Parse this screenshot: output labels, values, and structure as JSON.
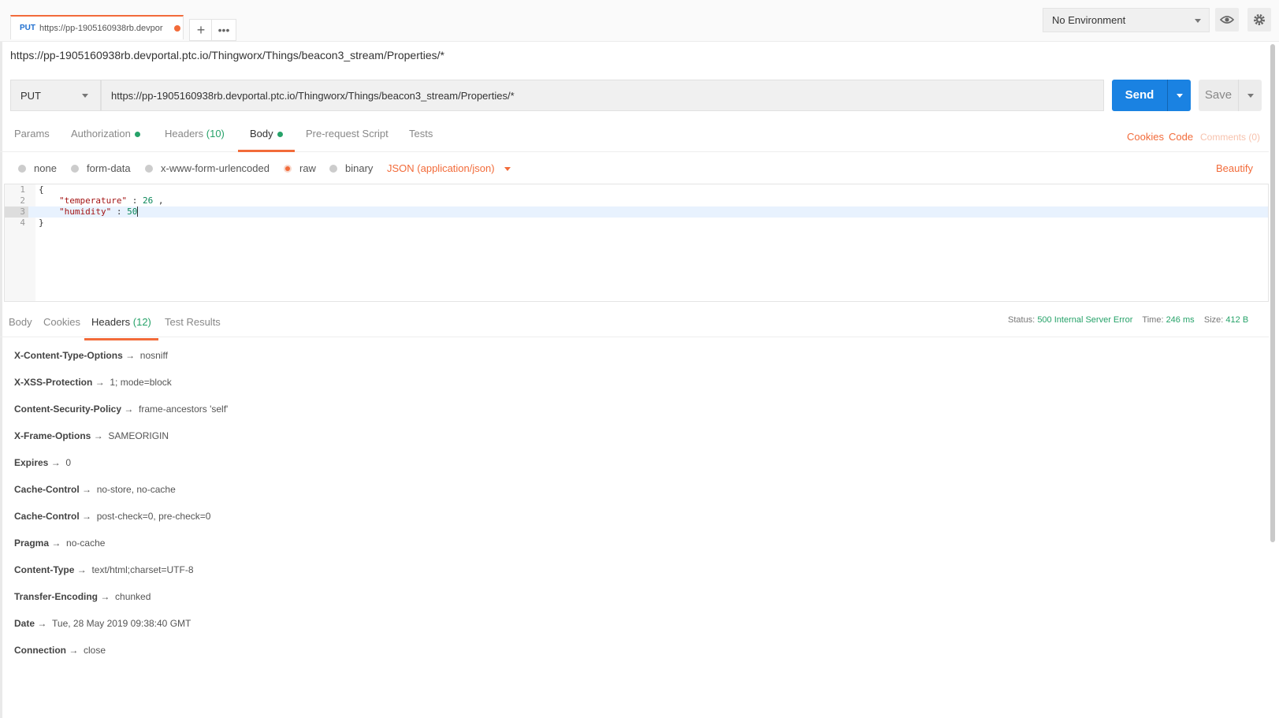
{
  "tab": {
    "method": "PUT",
    "url": "https://pp-1905160938rb.devpor"
  },
  "environment": {
    "selected": "No Environment"
  },
  "request": {
    "title": "https://pp-1905160938rb.devportal.ptc.io/Thingworx/Things/beacon3_stream/Properties/*",
    "method": "PUT",
    "url": "https://pp-1905160938rb.devportal.ptc.io/Thingworx/Things/beacon3_stream/Properties/*",
    "send_label": "Send",
    "save_label": "Save"
  },
  "request_tabs": {
    "params": "Params",
    "authorization": "Authorization",
    "headers": "Headers",
    "headers_count": "(10)",
    "body": "Body",
    "prerequest": "Pre-request Script",
    "tests": "Tests"
  },
  "right_links": {
    "cookies": "Cookies",
    "code": "Code",
    "comments": "Comments (0)"
  },
  "body_types": {
    "none": "none",
    "form_data": "form-data",
    "urlencoded": "x-www-form-urlencoded",
    "raw": "raw",
    "binary": "binary",
    "format": "JSON (application/json)",
    "beautify": "Beautify"
  },
  "editor": {
    "lines": [
      "1",
      "2",
      "3",
      "4"
    ],
    "open": "{",
    "key1": "\"temperature\"",
    "sep1": " : ",
    "val1": "26",
    "tail1": " ,",
    "key2": "\"humidity\"",
    "sep2": " : ",
    "val2": "50",
    "close": "}"
  },
  "response_tabs": {
    "body": "Body",
    "cookies": "Cookies",
    "headers": "Headers",
    "headers_count": "(12)",
    "tests": "Test Results"
  },
  "status": {
    "status_label": "Status:",
    "status_value": "500 Internal Server Error",
    "time_label": "Time:",
    "time_value": "246 ms",
    "size_label": "Size:",
    "size_value": "412 B"
  },
  "response_headers": [
    {
      "key": "X-Content-Type-Options",
      "value": "nosniff"
    },
    {
      "key": "X-XSS-Protection",
      "value": "1; mode=block"
    },
    {
      "key": "Content-Security-Policy",
      "value": "frame-ancestors 'self'"
    },
    {
      "key": "X-Frame-Options",
      "value": "SAMEORIGIN"
    },
    {
      "key": "Expires",
      "value": "0"
    },
    {
      "key": "Cache-Control",
      "value": "no-store, no-cache"
    },
    {
      "key": "Cache-Control",
      "value": "post-check=0, pre-check=0"
    },
    {
      "key": "Pragma",
      "value": "no-cache"
    },
    {
      "key": "Content-Type",
      "value": "text/html;charset=UTF-8"
    },
    {
      "key": "Transfer-Encoding",
      "value": "chunked"
    },
    {
      "key": "Date",
      "value": "Tue, 28 May 2019 09:38:40 GMT"
    },
    {
      "key": "Connection",
      "value": "close"
    }
  ],
  "arrow": "→"
}
